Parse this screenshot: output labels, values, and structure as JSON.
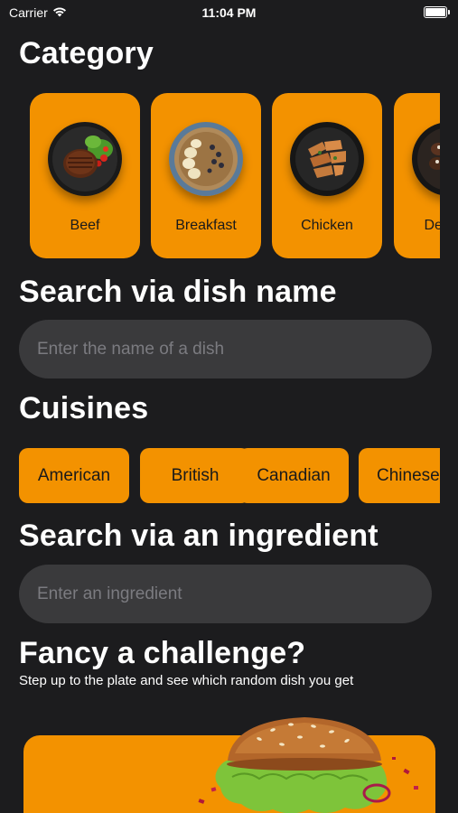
{
  "status_bar": {
    "carrier": "Carrier",
    "time": "11:04 PM"
  },
  "category": {
    "title": "Category",
    "items": [
      {
        "label": "Beef"
      },
      {
        "label": "Breakfast"
      },
      {
        "label": "Chicken"
      },
      {
        "label": "Dessert"
      }
    ]
  },
  "dish_search": {
    "title": "Search via dish name",
    "placeholder": "Enter the name of a dish"
  },
  "cuisines": {
    "title": "Cuisines",
    "items": [
      {
        "label": "American"
      },
      {
        "label": "British"
      },
      {
        "label": "Canadian"
      },
      {
        "label": "Chinese"
      }
    ]
  },
  "ingredient_search": {
    "title": "Search via an ingredient",
    "placeholder": "Enter an ingredient"
  },
  "challenge": {
    "title": "Fancy a challenge?",
    "subtitle": "Step up to the plate and see which random dish you get"
  },
  "colors": {
    "background": "#1c1c1e",
    "accent": "#f39200",
    "field": "#3a3a3c"
  }
}
